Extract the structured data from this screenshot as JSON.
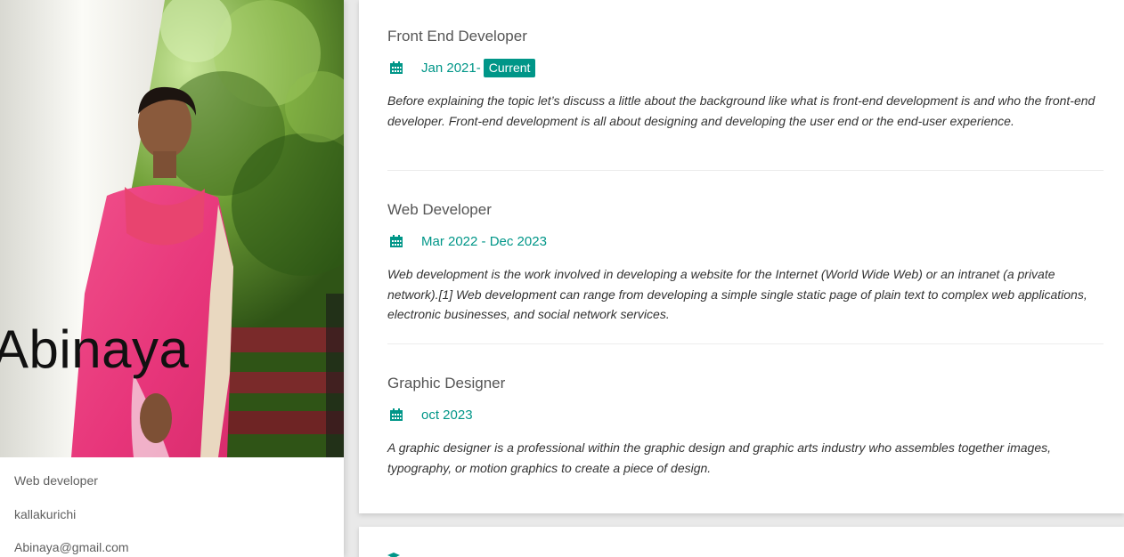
{
  "profile": {
    "name": "Abinaya",
    "title": "Web developer",
    "location": "kallakurichi",
    "email": "Abinaya@gmail.com"
  },
  "experience": [
    {
      "title": "Front End Developer",
      "date": "Jan 2021-",
      "badge": "Current",
      "description": "Before explaining the topic let’s discuss a little about the background like what is front-end development is and who the front-end developer. Front-end development is all about designing and developing the user end or the end-user experience."
    },
    {
      "title": "Web Developer",
      "date": "Mar 2022 - Dec 2023",
      "description": "Web development is the work involved in developing a website for the Internet (World Wide Web) or an intranet (a private network).[1] Web development can range from developing a simple single static page of plain text to complex web applications, electronic businesses, and social network services."
    },
    {
      "title": "Graphic Designer",
      "date": "oct 2023",
      "description": "A graphic designer is a professional within the graphic design and graphic arts industry who assembles together images, typography, or motion graphics to create a piece of design."
    }
  ],
  "icons": {
    "date": "calendar-icon",
    "next_section": "graduation-cap-icon"
  },
  "colors": {
    "accent": "#009688",
    "title_text": "#555555",
    "body_text": "#333333",
    "muted_text": "#5f5f5f",
    "page_background": "#e9e9e9"
  }
}
